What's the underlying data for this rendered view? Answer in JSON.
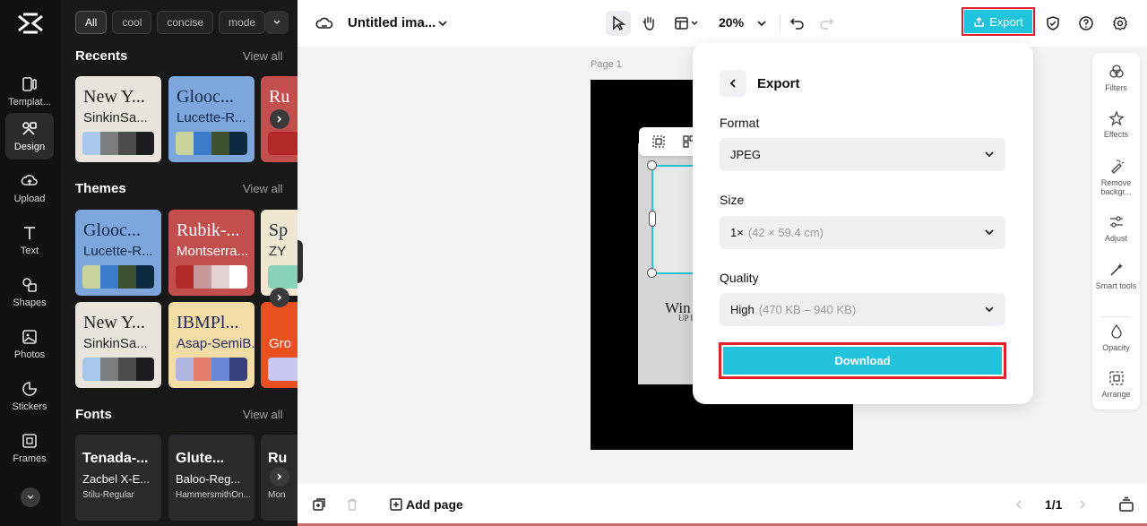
{
  "rail": {
    "items": [
      {
        "label": "Templat...",
        "icon": "templates-icon"
      },
      {
        "label": "Design",
        "icon": "design-icon",
        "active": true
      },
      {
        "label": "Upload",
        "icon": "upload-icon"
      },
      {
        "label": "Text",
        "icon": "text-icon"
      },
      {
        "label": "Shapes",
        "icon": "shapes-icon"
      },
      {
        "label": "Photos",
        "icon": "photos-icon"
      },
      {
        "label": "Stickers",
        "icon": "stickers-icon"
      },
      {
        "label": "Frames",
        "icon": "frames-icon"
      }
    ]
  },
  "panel": {
    "chips": [
      "All",
      "cool",
      "concise",
      "mode"
    ],
    "sections": {
      "recents": {
        "title": "Recents",
        "view_all": "View all"
      },
      "themes": {
        "title": "Themes",
        "view_all": "View all"
      },
      "fonts": {
        "title": "Fonts",
        "view_all": "View all"
      }
    },
    "recents": [
      {
        "t1": "New Y...",
        "t2": "SinkinSa...",
        "bg": "#e9e4dc",
        "fg": "#222222",
        "swatches": [
          "#a7c8ea",
          "#7b7d81",
          "#4b4c50",
          "#1b1c20"
        ]
      },
      {
        "t1": "Glooc...",
        "t2": "Lucette-R...",
        "bg": "#7da7dc",
        "fg": "#10284a",
        "swatches": [
          "#c9d49c",
          "#3a7ccb",
          "#3e5230",
          "#0e2a40"
        ]
      },
      {
        "t1": "Ru",
        "t2": "",
        "bg": "#c24e4e",
        "fg": "#ffffff",
        "swatches": [
          "#b32a2a"
        ]
      }
    ],
    "themes": [
      {
        "t1": "Glooc...",
        "t2": "Lucette-R...",
        "bg": "#7da7dc",
        "fg": "#10284a",
        "swatches": [
          "#c9d49c",
          "#3a7ccb",
          "#3e5230",
          "#0e2a40"
        ]
      },
      {
        "t1": "Rubik-...",
        "t2": "Montserra...",
        "bg": "#c24e4e",
        "fg": "#ffffff",
        "swatches": [
          "#b32a2a",
          "#c69a9a",
          "#e3d2d2",
          "#ffffff"
        ]
      },
      {
        "t1": "Sp",
        "t2": "ZY",
        "bg": "#efe7d2",
        "fg": "#1e2a36",
        "swatches": [
          "#87d2b9"
        ]
      },
      {
        "t1": "New Y...",
        "t2": "SinkinSa...",
        "bg": "#e9e4dc",
        "fg": "#222222",
        "swatches": [
          "#a7c8ea",
          "#7b7d81",
          "#4b4c50",
          "#1b1c20"
        ]
      },
      {
        "t1": "IBMPl...",
        "t2": "Asap-SemiB...",
        "bg": "#f2dda6",
        "fg": "#262b60",
        "swatches": [
          "#b0b6e0",
          "#e27d6a",
          "#6b86d4",
          "#37407a"
        ]
      },
      {
        "t1": "",
        "t2": "Gro",
        "bg": "#e8511f",
        "fg": "#ffffff",
        "swatches": [
          "#c8c8f0"
        ]
      }
    ],
    "fonts": [
      {
        "f1": "Tenada-...",
        "f2": "Zacbel X-E...",
        "f3": "Stilu-Regular"
      },
      {
        "f1": "Glute...",
        "f2": "Baloo-Reg...",
        "f3": "HammersmithOn..."
      },
      {
        "f1": "Ru",
        "f2": "",
        "f3": "Mon"
      }
    ]
  },
  "topbar": {
    "title": "Untitled ima...",
    "zoom": "20%",
    "export_label": "Export"
  },
  "canvas": {
    "page_label": "Page 1",
    "text_line1": "Win",
    "text_line2": "UP I"
  },
  "tools": [
    {
      "label": "Filters",
      "icon": "filters-icon"
    },
    {
      "label": "Effects",
      "icon": "effects-icon"
    },
    {
      "label": "Remove backgr...",
      "icon": "remove-background-icon"
    },
    {
      "label": "Adjust",
      "icon": "adjust-icon"
    },
    {
      "label": "Smart tools",
      "icon": "smart-tools-icon"
    },
    {
      "label": "Opacity",
      "icon": "opacity-icon"
    },
    {
      "label": "Arrange",
      "icon": "arrange-icon"
    }
  ],
  "export_panel": {
    "title": "Export",
    "format_label": "Format",
    "format_value": "JPEG",
    "size_label": "Size",
    "size_value": "1×",
    "size_detail": "(42 × 59.4 cm)",
    "quality_label": "Quality",
    "quality_value": "High",
    "quality_detail": "(470 KB – 940 KB)",
    "download_label": "Download"
  },
  "bottombar": {
    "add_page": "Add page",
    "page_count": "1/1"
  },
  "colors": {
    "accent": "#22c3dc",
    "highlight": "#e0202a"
  }
}
